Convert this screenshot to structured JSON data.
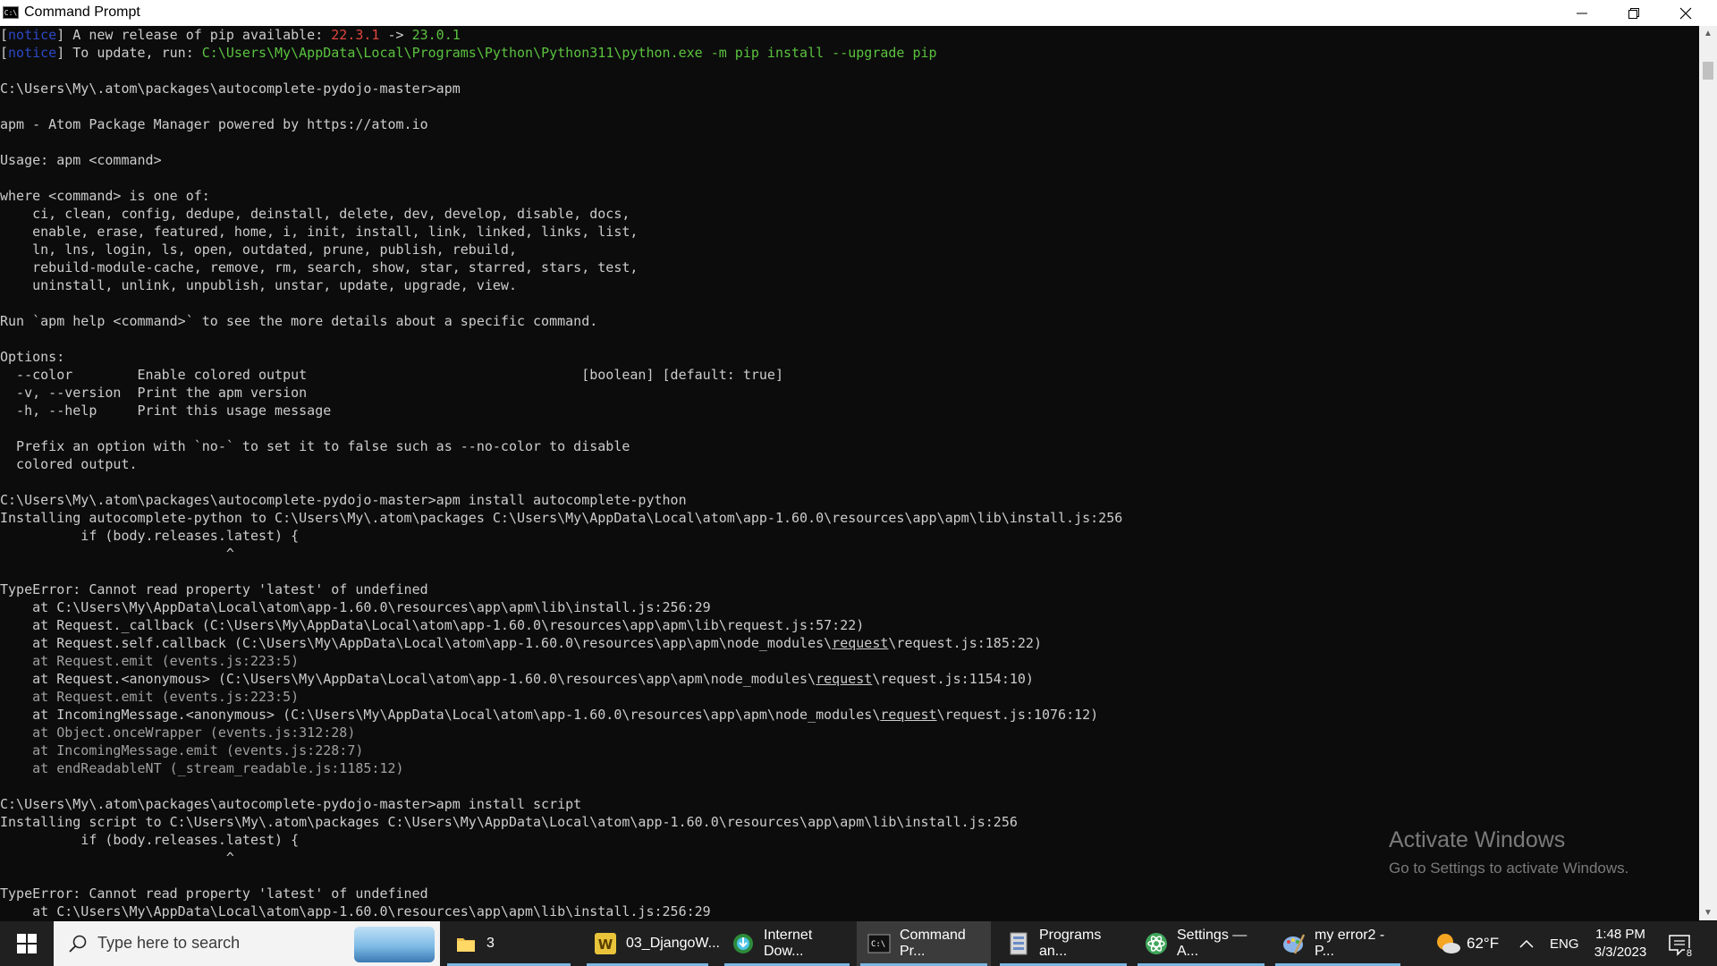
{
  "window": {
    "title": "Command Prompt",
    "icon_label": "C:\\",
    "controls": [
      "minimize-icon",
      "restore-icon",
      "close-icon"
    ]
  },
  "console": {
    "lines": [
      [
        {
          "t": "[",
          "c": ""
        },
        {
          "t": "notice",
          "c": "c-blue"
        },
        {
          "t": "] A new release of pip available: ",
          "c": ""
        },
        {
          "t": "22.3.1",
          "c": "c-red"
        },
        {
          "t": " -> ",
          "c": ""
        },
        {
          "t": "23.0.1",
          "c": "c-green"
        }
      ],
      [
        {
          "t": "[",
          "c": ""
        },
        {
          "t": "notice",
          "c": "c-blue"
        },
        {
          "t": "] To update, run: ",
          "c": ""
        },
        {
          "t": "C:\\Users\\My\\AppData\\Local\\Programs\\Python\\Python311\\python.exe -m pip install --upgrade pip",
          "c": "c-green"
        }
      ],
      [],
      [
        {
          "t": "C:\\Users\\My\\.atom\\packages\\autocomplete-pydojo-master>apm",
          "c": ""
        }
      ],
      [],
      [
        {
          "t": "apm - Atom Package Manager powered by https://atom.io",
          "c": ""
        }
      ],
      [],
      [
        {
          "t": "Usage: apm <command>",
          "c": ""
        }
      ],
      [],
      [
        {
          "t": "where <command> is one of:",
          "c": ""
        }
      ],
      [
        {
          "t": "    ci, clean, config, dedupe, deinstall, delete, dev, develop, disable, docs,",
          "c": ""
        }
      ],
      [
        {
          "t": "    enable, erase, featured, home, i, init, install, link, linked, links, list,",
          "c": ""
        }
      ],
      [
        {
          "t": "    ln, lns, login, ls, open, outdated, prune, publish, rebuild,",
          "c": ""
        }
      ],
      [
        {
          "t": "    rebuild-module-cache, remove, rm, search, show, star, starred, stars, test,",
          "c": ""
        }
      ],
      [
        {
          "t": "    uninstall, unlink, unpublish, unstar, update, upgrade, view.",
          "c": ""
        }
      ],
      [],
      [
        {
          "t": "Run `apm help <command>` to see the more details about a specific command.",
          "c": ""
        }
      ],
      [],
      [
        {
          "t": "Options:",
          "c": ""
        }
      ],
      [
        {
          "t": "  --color        Enable colored output                                  [boolean] [default: true]",
          "c": ""
        }
      ],
      [
        {
          "t": "  -v, --version  Print the apm version",
          "c": ""
        }
      ],
      [
        {
          "t": "  -h, --help     Print this usage message",
          "c": ""
        }
      ],
      [],
      [
        {
          "t": "  Prefix an option with `no-` to set it to false such as --no-color to disable",
          "c": ""
        }
      ],
      [
        {
          "t": "  colored output.",
          "c": ""
        }
      ],
      [],
      [
        {
          "t": "C:\\Users\\My\\.atom\\packages\\autocomplete-pydojo-master>apm install autocomplete-python",
          "c": ""
        }
      ],
      [
        {
          "t": "Installing autocomplete-python to C:\\Users\\My\\.atom\\packages C:\\Users\\My\\AppData\\Local\\atom\\app-1.60.0\\resources\\app\\apm\\lib\\install.js:256",
          "c": ""
        }
      ],
      [
        {
          "t": "          if (body.releases.latest) {",
          "c": ""
        }
      ],
      [
        {
          "t": "                            ^",
          "c": ""
        }
      ],
      [],
      [
        {
          "t": "TypeError: Cannot read property 'latest' of undefined",
          "c": ""
        }
      ],
      [
        {
          "t": "    at C:\\Users\\My\\AppData\\Local\\atom\\app-1.60.0\\resources\\app\\apm\\lib\\install.js:256:29",
          "c": ""
        }
      ],
      [
        {
          "t": "    at Request._callback (C:\\Users\\My\\AppData\\Local\\atom\\app-1.60.0\\resources\\app\\apm\\lib\\request.js:57:22)",
          "c": ""
        }
      ],
      [
        {
          "t": "    at Request.self.callback (C:\\Users\\My\\AppData\\Local\\atom\\app-1.60.0\\resources\\app\\apm\\node_modules\\",
          "c": ""
        },
        {
          "t": "request",
          "c": "u"
        },
        {
          "t": "\\request.js:185:22)",
          "c": ""
        }
      ],
      [
        {
          "t": "    at Request.emit (events.js:223:5)",
          "c": "c-dim"
        }
      ],
      [
        {
          "t": "    at Request.<anonymous> (C:\\Users\\My\\AppData\\Local\\atom\\app-1.60.0\\resources\\app\\apm\\node_modules\\",
          "c": ""
        },
        {
          "t": "request",
          "c": "u"
        },
        {
          "t": "\\request.js:1154:10)",
          "c": ""
        }
      ],
      [
        {
          "t": "    at Request.emit (events.js:223:5)",
          "c": "c-dim"
        }
      ],
      [
        {
          "t": "    at IncomingMessage.<anonymous> (C:\\Users\\My\\AppData\\Local\\atom\\app-1.60.0\\resources\\app\\apm\\node_modules\\",
          "c": ""
        },
        {
          "t": "request",
          "c": "u"
        },
        {
          "t": "\\request.js:1076:12)",
          "c": ""
        }
      ],
      [
        {
          "t": "    at Object.onceWrapper (events.js:312:28)",
          "c": "c-dim"
        }
      ],
      [
        {
          "t": "    at IncomingMessage.emit (events.js:228:7)",
          "c": "c-dim"
        }
      ],
      [
        {
          "t": "    at endReadableNT (_stream_readable.js:1185:12)",
          "c": "c-dim"
        }
      ],
      [],
      [
        {
          "t": "C:\\Users\\My\\.atom\\packages\\autocomplete-pydojo-master>apm install script",
          "c": ""
        }
      ],
      [
        {
          "t": "Installing script to C:\\Users\\My\\.atom\\packages C:\\Users\\My\\AppData\\Local\\atom\\app-1.60.0\\resources\\app\\apm\\lib\\install.js:256",
          "c": ""
        }
      ],
      [
        {
          "t": "          if (body.releases.latest) {",
          "c": ""
        }
      ],
      [
        {
          "t": "                            ^",
          "c": ""
        }
      ],
      [],
      [
        {
          "t": "TypeError: Cannot read property 'latest' of undefined",
          "c": ""
        }
      ],
      [
        {
          "t": "    at C:\\Users\\My\\AppData\\Local\\atom\\app-1.60.0\\resources\\app\\apm\\lib\\install.js:256:29",
          "c": ""
        }
      ]
    ]
  },
  "watermark": {
    "line1": "Activate Windows",
    "line2": "Go to Settings to activate Windows."
  },
  "taskbar": {
    "search_placeholder": "Type here to search",
    "items": [
      {
        "label": "3",
        "icon": "folder-icon",
        "active": false
      },
      {
        "label": "03_DjangoW...",
        "icon": "django-doc-icon",
        "active": false
      },
      {
        "label": "Internet Dow...",
        "icon": "internet-download-icon",
        "active": false
      },
      {
        "label": "Command Pr...",
        "icon": "command-prompt-icon",
        "active": true
      },
      {
        "label": "Programs an...",
        "icon": "programs-features-icon",
        "active": false
      },
      {
        "label": "Settings — A...",
        "icon": "atom-settings-icon",
        "active": false
      },
      {
        "label": "my error2 - P...",
        "icon": "paint-icon",
        "active": false
      }
    ],
    "weather": {
      "temp": "62°F",
      "icon": "weather-icon"
    },
    "language": "ENG",
    "time": "1:48 PM",
    "date": "3/3/2023",
    "notification_count": "8"
  },
  "colors": {
    "console_bg": "#0c0c0c",
    "console_fg": "#cccccc",
    "pip_old": "#e0463c",
    "pip_new": "#5ac23f",
    "notice": "#2d49c6",
    "taskbar_bg": "#202020",
    "taskbar_active_underline": "#7cb6e3"
  }
}
